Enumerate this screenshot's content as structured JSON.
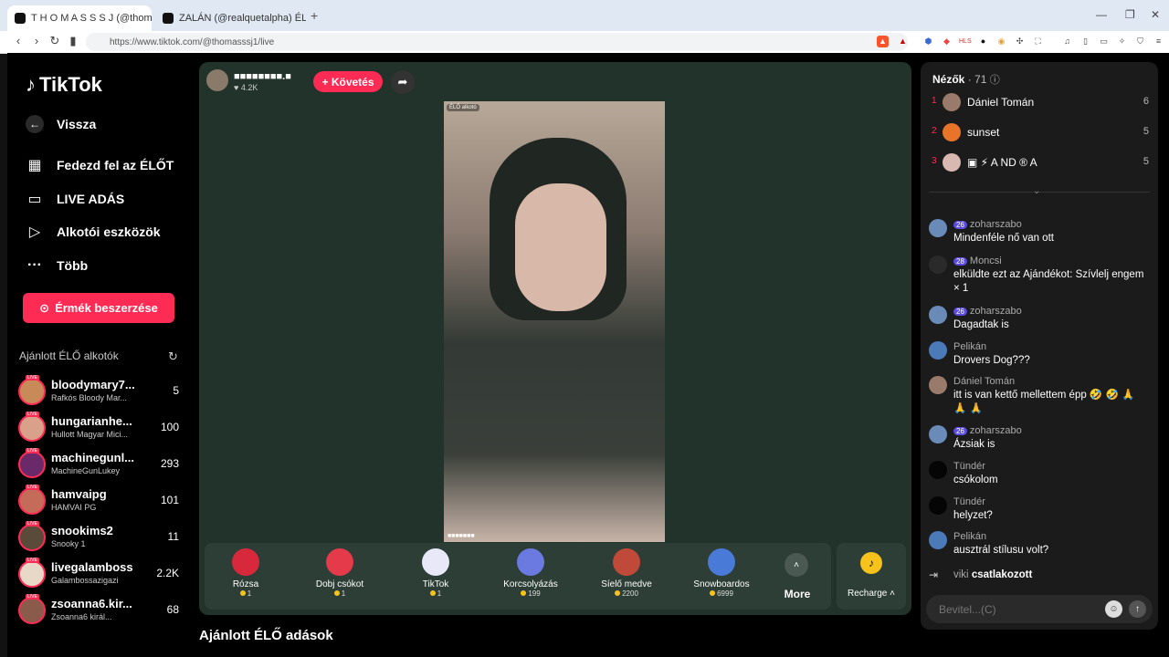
{
  "browser": {
    "tabs": [
      {
        "title": "T H O M A S S S J (@thom",
        "active": true
      },
      {
        "title": "ZALÁN (@realquetalpha) ÉLŐ",
        "active": false
      }
    ],
    "url": "https://www.tiktok.com/@thomasssj1/live"
  },
  "sidebar": {
    "logo": "TikTok",
    "back_label": "Vissza",
    "nav": [
      {
        "label": "Fedezd fel az ÉLŐT",
        "icon": "calendar-live-icon"
      },
      {
        "label": "LIVE ADÁS",
        "icon": "video-camera-icon"
      },
      {
        "label": "Alkotói eszközök",
        "icon": "play-circle-icon"
      },
      {
        "label": "Több",
        "icon": "more-dots-icon"
      }
    ],
    "coins_button": "Érmék beszerzése",
    "recommended_title": "Ajánlott ÉLŐ alkotók",
    "live_tag": "LIVE",
    "creators": [
      {
        "name": "bloodymary7...",
        "sub": "Rafkós Bloody Mar...",
        "count": "5",
        "color": "#c98a5a"
      },
      {
        "name": "hungarianhe...",
        "sub": "Hullott Magyar Mici...",
        "count": "100",
        "color": "#d9a08a"
      },
      {
        "name": "machinegunl...",
        "sub": "MachineGunLukey",
        "count": "293",
        "color": "#6a2a6a"
      },
      {
        "name": "hamvaipg",
        "sub": "HAMVAI PG",
        "count": "101",
        "color": "#c46b5a"
      },
      {
        "name": "snookims2",
        "sub": "Snooky 1",
        "count": "11",
        "color": "#5a4a3a"
      },
      {
        "name": "livegalamboss",
        "sub": "Galambossazigazi",
        "count": "2.2K",
        "color": "#e8d8c8"
      },
      {
        "name": "zsoanna6.kir...",
        "sub": "Zsoanna6 királ...",
        "count": "68",
        "color": "#8a5a4a"
      }
    ],
    "bottom_partial": "Ajánlott ÉLŐ adások"
  },
  "stream": {
    "host_name": "■■■■■■■■.■",
    "likes": "4.2K",
    "follow_label": "+ Követés",
    "video_tag": "ÉLŐ alkotó",
    "video_caption": "■■■■■■■"
  },
  "gifts": [
    {
      "name": "Rózsa",
      "price": "1",
      "color": "#d8283c"
    },
    {
      "name": "Dobj csókot",
      "price": "1",
      "color": "#e43a4a"
    },
    {
      "name": "TikTok",
      "price": "1",
      "color": "#e8e8f8"
    },
    {
      "name": "Korcsolyázás",
      "price": "199",
      "color": "#6a7ae0"
    },
    {
      "name": "Síelő medve",
      "price": "2200",
      "color": "#c04a3a"
    },
    {
      "name": "Snowboardos",
      "price": "6999",
      "color": "#4a7ad8"
    }
  ],
  "gift_more": "More",
  "recharge": "Recharge",
  "viewers": {
    "title": "Nézők",
    "count": "· 71",
    "list": [
      {
        "rank": "1",
        "name": "Dániel Tomán",
        "score": "6"
      },
      {
        "rank": "2",
        "name": "sunset",
        "score": "5"
      },
      {
        "rank": "3",
        "name": "▣ ⚡ A ND ® A",
        "score": "5"
      }
    ]
  },
  "chat": [
    {
      "user": "zoharszabo",
      "level": "26",
      "msg": "Mindenféle nő van ott"
    },
    {
      "user": "Moncsi",
      "level": "28",
      "msg": "elküldte ezt az Ajándékot: Szívlelj engem × 1"
    },
    {
      "user": "zoharszabo",
      "level": "26",
      "msg": "Dagadtak is"
    },
    {
      "user": "Pelikán",
      "level": "",
      "msg": "Drovers Dog???"
    },
    {
      "user": "Dániel Tomán",
      "level": "",
      "msg": "itt is van kettő mellettem épp 🤣 🤣 🙏 🙏 🙏"
    },
    {
      "user": "zoharszabo",
      "level": "26",
      "msg": "Ázsiak is"
    },
    {
      "user": "Tündér",
      "level": "",
      "msg": "csókolom"
    },
    {
      "user": "Tündér",
      "level": "",
      "msg": "helyzet?"
    },
    {
      "user": "Pelikán",
      "level": "",
      "msg": "ausztrál stílusu volt?"
    }
  ],
  "joined": {
    "user": "viki",
    "text": "csatlakozott"
  },
  "chat_input_placeholder": "Bevitel...(C)"
}
